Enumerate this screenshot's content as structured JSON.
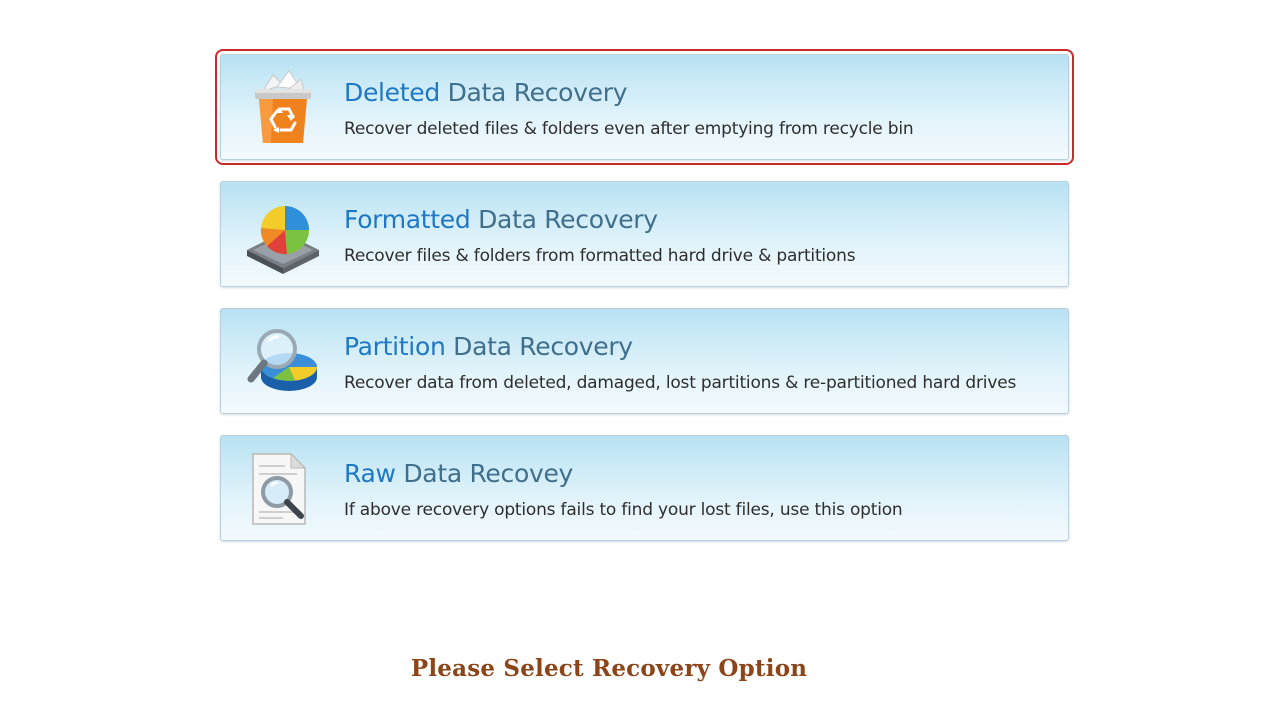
{
  "options": [
    {
      "keyword": "Deleted",
      "rest": " Data Recovery",
      "description": "Recover deleted files & folders even after emptying from recycle bin",
      "icon": "recycle-bin-icon"
    },
    {
      "keyword": "Formatted",
      "rest": " Data Recovery",
      "description": "Recover files & folders from formatted hard drive & partitions",
      "icon": "formatted-drive-icon"
    },
    {
      "keyword": "Partition",
      "rest": " Data Recovery",
      "description": "Recover data from deleted, damaged, lost partitions  & re-partitioned hard drives",
      "icon": "partition-search-icon"
    },
    {
      "keyword": "Raw",
      "rest": " Data Recovey",
      "description": "If above recovery options fails to find your lost files, use this option",
      "icon": "document-search-icon"
    }
  ],
  "footer": {
    "message": "Please Select Recovery Option"
  },
  "colors": {
    "keyword": "#1f78c4",
    "title_rest": "#3f6f8c",
    "selection_outline": "#cc2a2a",
    "footer": "#8b4519"
  }
}
